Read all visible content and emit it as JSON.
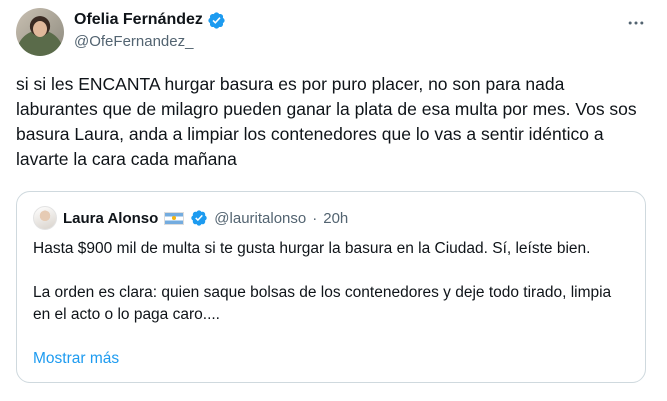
{
  "author": {
    "display_name": "Ofelia Fernández",
    "handle": "@OfeFernandez_",
    "verified": true,
    "avatar_icon": "user-avatar"
  },
  "tweet": {
    "text": "si si les ENCANTA hurgar basura es por puro placer, no son para nada laburantes que de milagro pueden ganar la plata de esa multa por mes. Vos sos basura Laura, anda a limpiar los contenedores que lo vas a sentir idéntico a lavarte la cara cada mañana"
  },
  "quoted": {
    "display_name": "Laura Alonso",
    "flag": "argentina-flag",
    "verified": true,
    "handle": "@lauritalonso",
    "separator": "·",
    "time": "20h",
    "paragraph_1": "Hasta $900 mil de multa si te gusta hurgar la basura en la Ciudad. Sí, leíste bien.",
    "paragraph_2": "La orden es clara: quien saque bolsas de los contenedores y deje todo tirado, limpia en el acto o lo paga caro....",
    "show_more": "Mostrar más"
  },
  "colors": {
    "verified_blue": "#1d9bf0",
    "link_blue": "#1d9bf0",
    "secondary_text": "#536471",
    "border": "#cfd9de"
  }
}
